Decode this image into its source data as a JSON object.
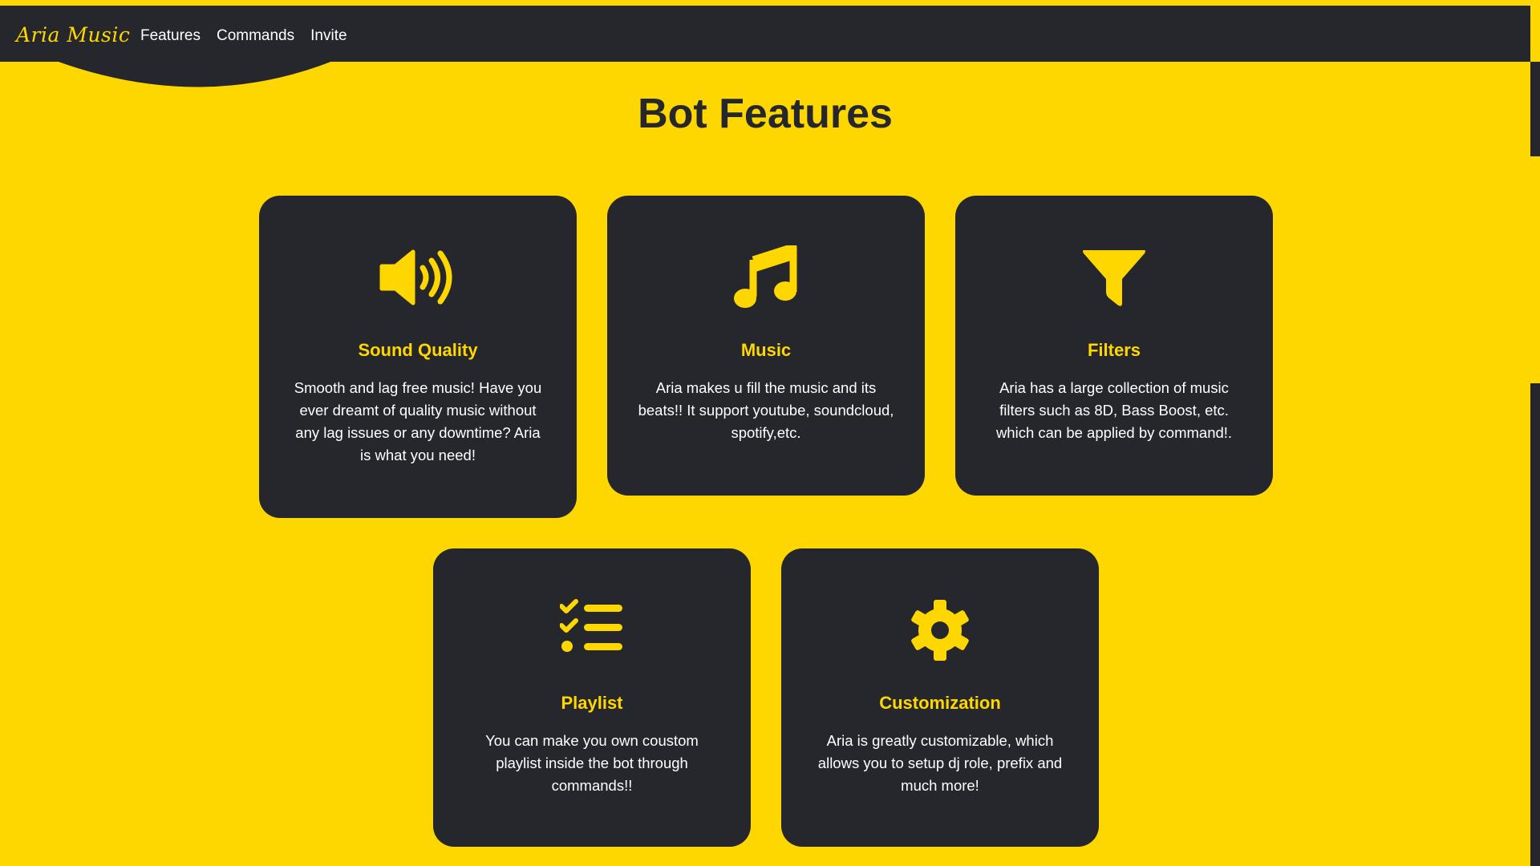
{
  "nav": {
    "brand": "Aria Music",
    "links": [
      "Features",
      "Commands",
      "Invite"
    ]
  },
  "page_title": "Bot Features",
  "cards": [
    {
      "icon": "speaker-icon",
      "title": "Sound Quality",
      "description": "Smooth and lag free music! Have you ever dreamt of quality music without any lag issues or any downtime? Aria is what you need!"
    },
    {
      "icon": "music-note-icon",
      "title": "Music",
      "description": "Aria makes u fill the music and its beats!! It support youtube, soundcloud, spotify,etc."
    },
    {
      "icon": "filter-icon",
      "title": "Filters",
      "description": "Aria has a large collection of music filters such as 8D, Bass Boost, etc. which can be applied by command!."
    },
    {
      "icon": "checklist-icon",
      "title": "Playlist",
      "description": "You can make you own coustom playlist inside the bot through commands!!"
    },
    {
      "icon": "gear-icon",
      "title": "Customization",
      "description": "Aria is greatly customizable, which allows you to setup dj role, prefix and much more!"
    }
  ],
  "colors": {
    "background": "#ffd700",
    "dark": "#25272c",
    "accent": "#ffd700",
    "text_light": "#ffffff"
  }
}
